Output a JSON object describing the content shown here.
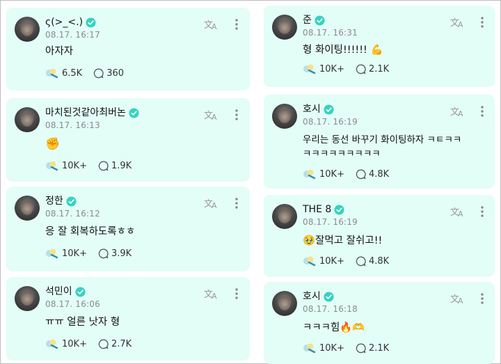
{
  "left_posts": [
    {
      "name": "ς(>_<.)",
      "time": "08.17. 16:17",
      "text": "아자자",
      "likes": "6.5K",
      "comments": "360"
    },
    {
      "name": "마치된것같아최버논",
      "time": "08.17. 16:13",
      "text": "✊",
      "likes": "10K+",
      "comments": "1.9K"
    },
    {
      "name": "정한",
      "time": "08.17. 16:12",
      "text": "응 잘 회복하도록ㅎㅎ",
      "likes": "10K+",
      "comments": "3.9K"
    },
    {
      "name": "석민이",
      "time": "08.17. 16:06",
      "text": "ㅠㅠ 얼른 낫자 형",
      "likes": "10K+",
      "comments": "2.7K"
    }
  ],
  "right_posts": [
    {
      "name": "준",
      "time": "08.17. 16:31",
      "text": "형 화이팅!!!!!! 💪",
      "likes": "10K+",
      "comments": "2.1K"
    },
    {
      "name": "호시",
      "time": "08.17. 16:19",
      "text": "우리는 동선 바꾸기 화이팅하자 ㅋㅌㅋㅋ\nㅋㅋㅋㅋㅋㅋㅋㅋㅋ",
      "likes": "10K+",
      "comments": "4.8K"
    },
    {
      "name": "THE 8",
      "time": "08.17. 16:19",
      "text": "🥹잘먹고 잘쉬고!!",
      "likes": "10K+",
      "comments": "4.8K"
    },
    {
      "name": "호시",
      "time": "08.17. 16:18",
      "text": "ㅋㅋㅋ힘🔥🫶",
      "likes": "10K+",
      "comments": "2.1K"
    }
  ],
  "icons": {
    "verified": "verified-badge-icon",
    "translate": "translate-icon",
    "more": "more-vertical-icon",
    "light": "lightstick-icon",
    "comment": "comment-bubble-icon"
  },
  "colors": {
    "card_bg": "#e3fdf7",
    "verified": "#34d3c0",
    "icon_gray": "#9a9a9a"
  }
}
